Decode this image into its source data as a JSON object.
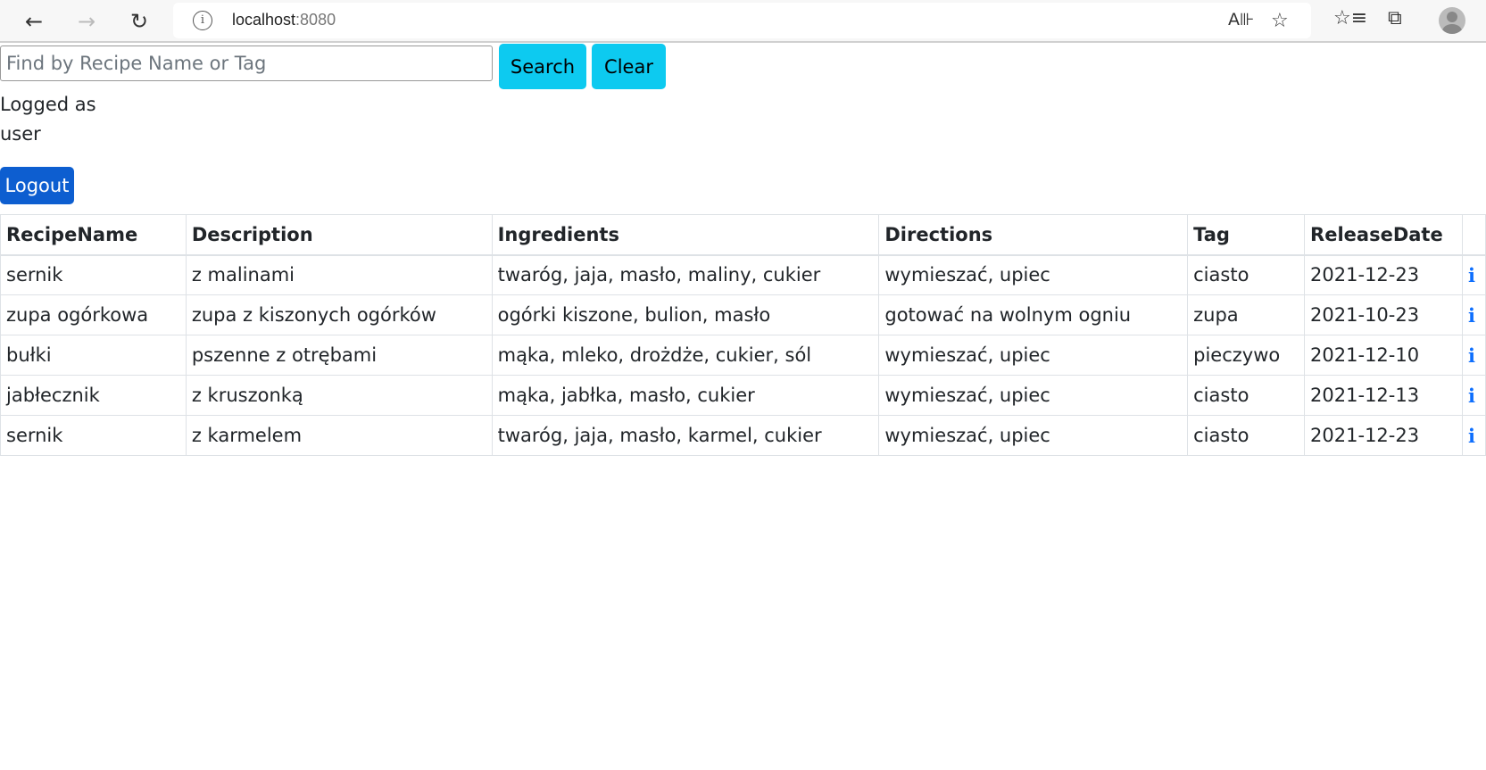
{
  "browser": {
    "url_host": "localhost",
    "url_port": ":8080"
  },
  "search": {
    "placeholder": "Find by Recipe Name or Tag",
    "value": "",
    "search_label": "Search",
    "clear_label": "Clear"
  },
  "user": {
    "logged_as": "Logged as",
    "username": "user",
    "logout_label": "Logout"
  },
  "table": {
    "headers": [
      "RecipeName",
      "Description",
      "Ingredients",
      "Directions",
      "Tag",
      "ReleaseDate",
      ""
    ],
    "rows": [
      {
        "name": "sernik",
        "description": "z malinami",
        "ingredients": "twaróg, jaja, masło, maliny, cukier",
        "directions": "wymieszać, upiec",
        "tag": "ciasto",
        "date": "2021-12-23",
        "action": "i"
      },
      {
        "name": "zupa ogórkowa",
        "description": "zupa z kiszonych ogórków",
        "ingredients": "ogórki kiszone, bulion, masło",
        "directions": "gotować na wolnym ogniu",
        "tag": "zupa",
        "date": "2021-10-23",
        "action": "i"
      },
      {
        "name": "bułki",
        "description": "pszenne z otrębami",
        "ingredients": "mąka, mleko, drożdże, cukier, sól",
        "directions": "wymieszać, upiec",
        "tag": "pieczywo",
        "date": "2021-12-10",
        "action": "i"
      },
      {
        "name": "jabłecznik",
        "description": "z kruszonką",
        "ingredients": "mąka, jabłka, masło, cukier",
        "directions": "wymieszać, upiec",
        "tag": "ciasto",
        "date": "2021-12-13",
        "action": "i"
      },
      {
        "name": "sernik",
        "description": "z karmelem",
        "ingredients": "twaróg, jaja, masło, karmel, cukier",
        "directions": "wymieszać, upiec",
        "tag": "ciasto",
        "date": "2021-12-23",
        "action": "i"
      }
    ]
  }
}
